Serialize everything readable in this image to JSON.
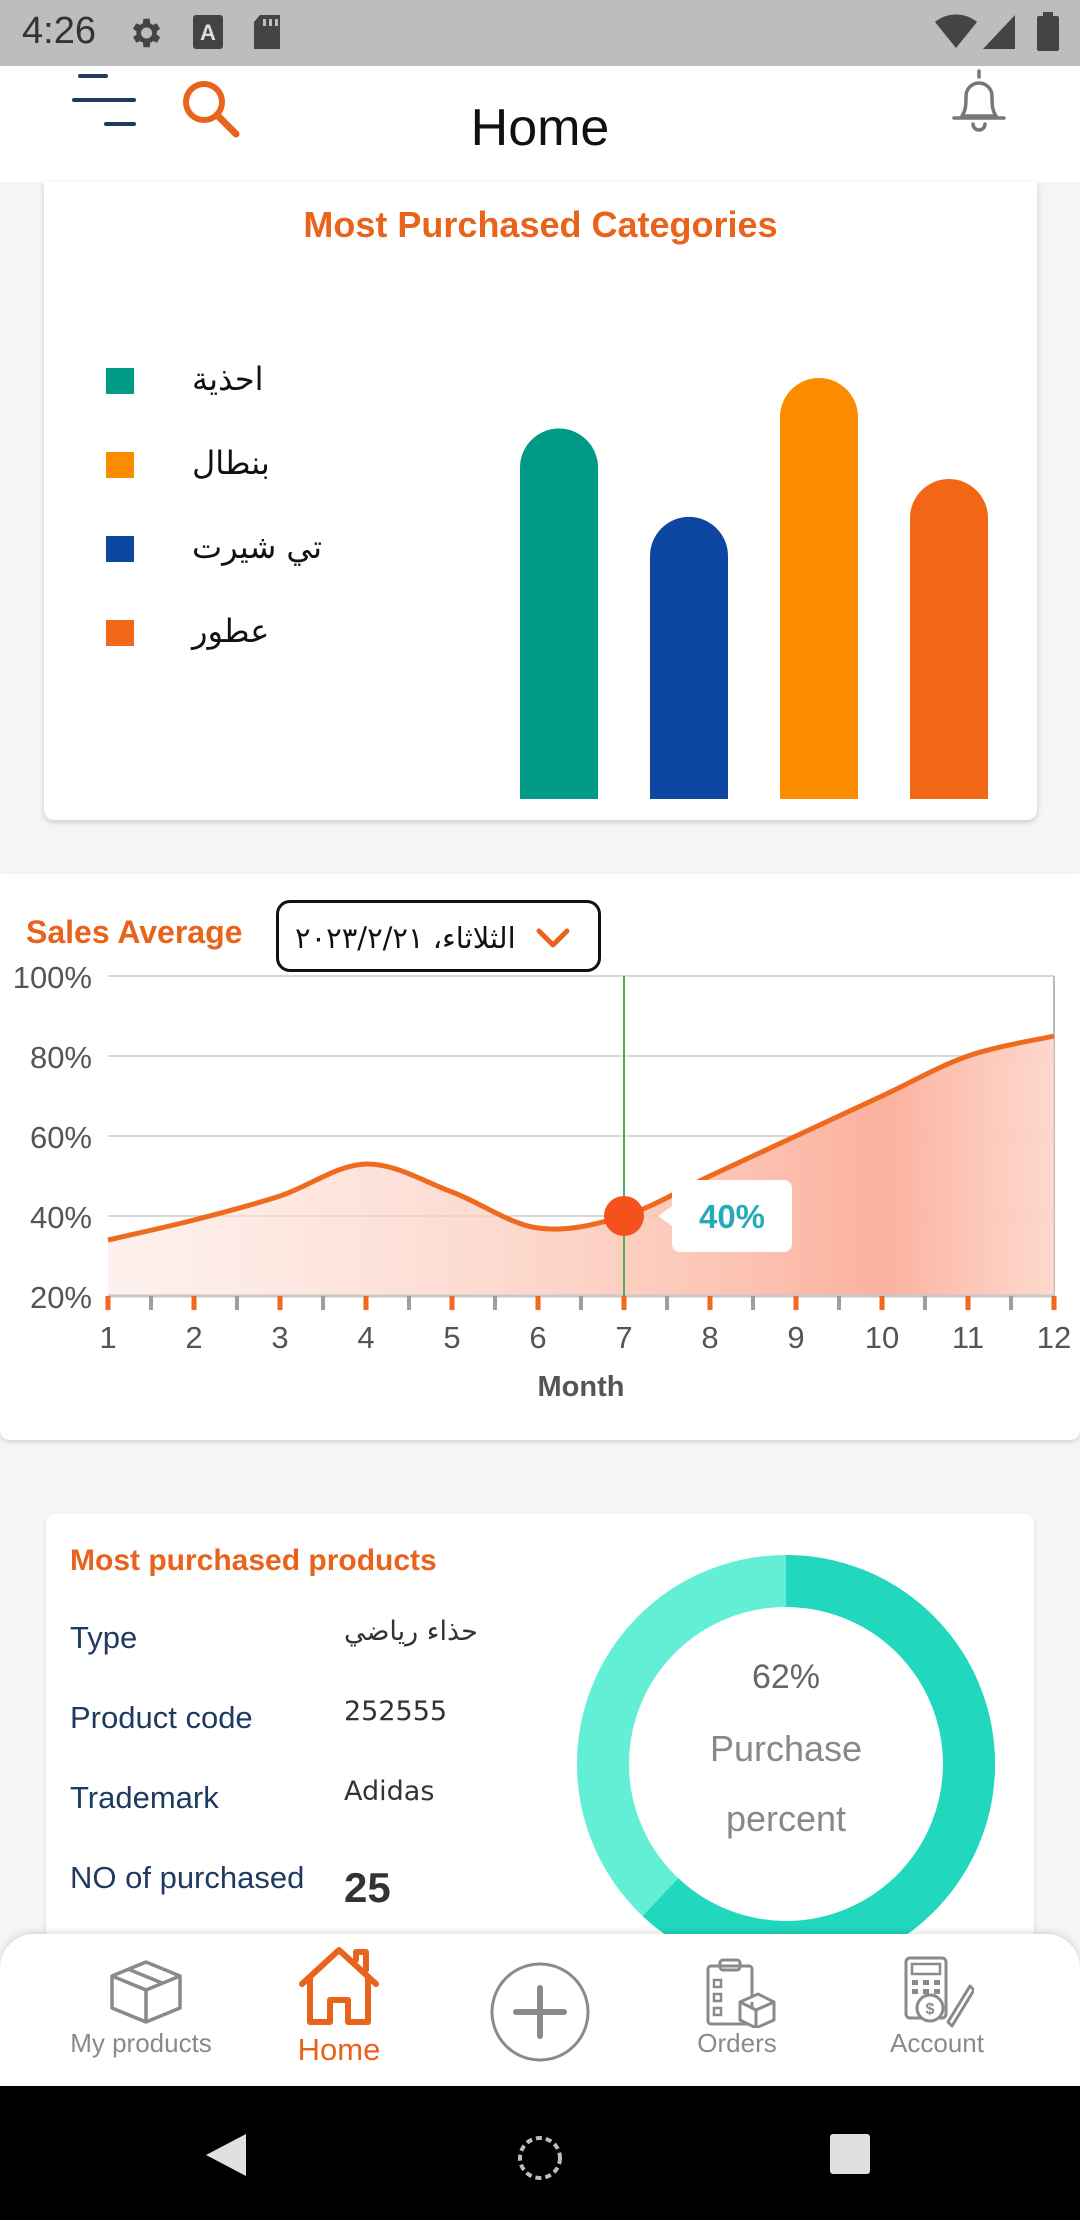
{
  "status_bar": {
    "time": "4:26",
    "icons": [
      "settings-icon",
      "a-icon",
      "sd-card-icon",
      "wifi-icon",
      "signal-icon",
      "battery-icon"
    ]
  },
  "header": {
    "title": "Home",
    "icons": [
      "menu-icon",
      "search-icon",
      "bell-icon"
    ],
    "accent": "#e8631b"
  },
  "categories_card": {
    "title": "Most Purchased Categories",
    "legend": [
      {
        "label": "احذية",
        "color": "#009a87"
      },
      {
        "label": "بنطال",
        "color": "#fb8c00"
      },
      {
        "label": "تي شيرت",
        "color": "#0d47a1"
      },
      {
        "label": "عطور",
        "color": "#f26716"
      }
    ],
    "chart_data": {
      "type": "bar",
      "title": "Most Purchased Categories",
      "categories": [
        "احذية",
        "تي شيرت",
        "بنطال",
        "عطور"
      ],
      "values": [
        88,
        67,
        100,
        76
      ],
      "colors": [
        "#009a87",
        "#0d47a1",
        "#fb8c00",
        "#f26716"
      ],
      "axes": false,
      "legend_position": "left"
    }
  },
  "sales_card": {
    "title": "Sales Average",
    "date": "الثلاثاء، ٢٠٢٣/٢/٢١",
    "tooltip": "40%",
    "chart_data": {
      "type": "area",
      "xlabel": "Month",
      "x": [
        1,
        2,
        3,
        4,
        5,
        6,
        7,
        8,
        9,
        10,
        11,
        12
      ],
      "y": [
        34,
        39,
        45,
        53,
        46,
        37,
        40,
        50,
        60,
        70,
        80,
        85
      ],
      "ylim": [
        20,
        100
      ],
      "yticks": [
        "20%",
        "40%",
        "60%",
        "80%",
        "100%"
      ],
      "xticks": [
        "1",
        "2",
        "3",
        "4",
        "5",
        "6",
        "7",
        "8",
        "9",
        "10",
        "11",
        "12"
      ],
      "highlight": {
        "x": 7,
        "y": 40,
        "label": "40%"
      },
      "grid": true,
      "line_color": "#ee6a1e",
      "marker_color": "#f4511e",
      "cursor_color": "#4caf50"
    }
  },
  "products_card": {
    "title": "Most purchased products",
    "rows": [
      {
        "label": "Type",
        "value": "حذاء رياضي"
      },
      {
        "label": "Product code",
        "value": "252555"
      },
      {
        "label": "Trademark",
        "value": "Adidas"
      },
      {
        "label": "NO of purchased",
        "value": "25"
      }
    ],
    "donut": {
      "percent_text": "62%",
      "label_line1": "Purchase",
      "label_line2": "percent",
      "percent": 62,
      "color_main": "#21d7bd",
      "color_rest": "#62efd6"
    }
  },
  "bottom_nav": {
    "items": [
      {
        "label": "My products",
        "icon": "box-icon"
      },
      {
        "label": "Home",
        "icon": "home-icon"
      },
      {
        "label": "",
        "icon": "add-icon"
      },
      {
        "label": "Orders",
        "icon": "orders-icon"
      },
      {
        "label": "Account",
        "icon": "account-icon"
      }
    ],
    "active": "Home"
  },
  "system_nav": [
    "back-icon",
    "home-circle-icon",
    "recents-icon"
  ]
}
